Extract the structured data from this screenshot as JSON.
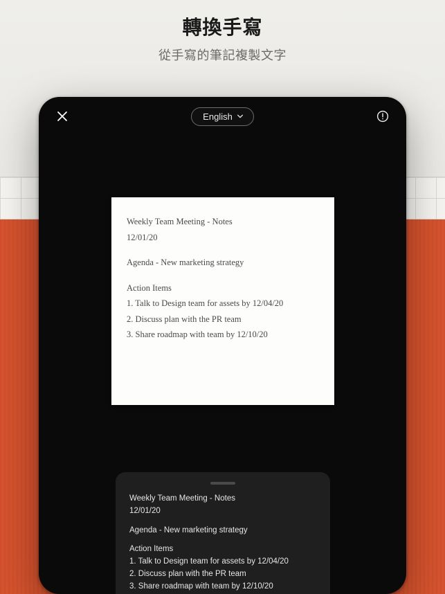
{
  "header": {
    "title": "轉換手寫",
    "subtitle": "從手寫的筆記複製文字"
  },
  "toolbar": {
    "language_label": "English"
  },
  "handwritten": {
    "line1": "Weekly Team Meeting - Notes",
    "line2": "12/01/20",
    "line3": "Agenda - New marketing strategy",
    "line4": "Action Items",
    "line5": "1. Talk to Design team for assets by 12/04/20",
    "line6": "2. Discuss plan with the PR team",
    "line7": "3. Share roadmap with team by 12/10/20"
  },
  "converted": {
    "line1": "Weekly Team Meeting - Notes",
    "line2": "12/01/20",
    "line3": "Agenda - New marketing strategy",
    "line4": "Action Items",
    "line5": "1. Talk to Design team for assets by 12/04/20",
    "line6": "2. Discuss plan with the PR team",
    "line7": "3. Share roadmap with team by 12/10/20"
  }
}
